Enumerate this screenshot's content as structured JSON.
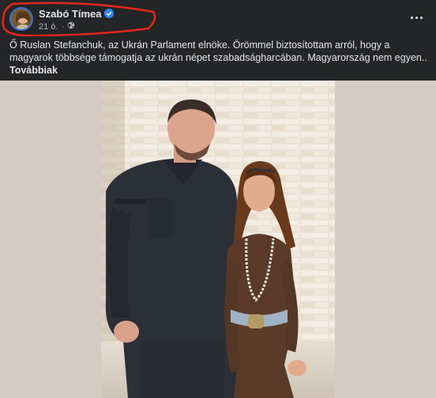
{
  "post": {
    "author": {
      "name": "Szabó Tímea",
      "verified_icon": "verified-badge-icon"
    },
    "meta": {
      "time": "21 ó.",
      "separator": "·",
      "audience_icon": "globe-icon"
    },
    "more_icon": "more-horizontal-icon",
    "text": {
      "line1": "Ő Ruslan Stefanchuk, az Ukrán Parlament elnöke. Örömmel biztosítottam arról, hogy a",
      "line2": "magyarok többsége támogatja az ukrán népet szabadságharcában. Magyarország nem egyen...",
      "see_more": "Továbbiak"
    }
  },
  "colors": {
    "background": "#242526",
    "text_primary": "#e4e6eb",
    "text_secondary": "#b0b3b8",
    "verified_blue": "#2d88ff",
    "annotation_red": "#e3261c",
    "media_background": "#d5cbc2"
  }
}
